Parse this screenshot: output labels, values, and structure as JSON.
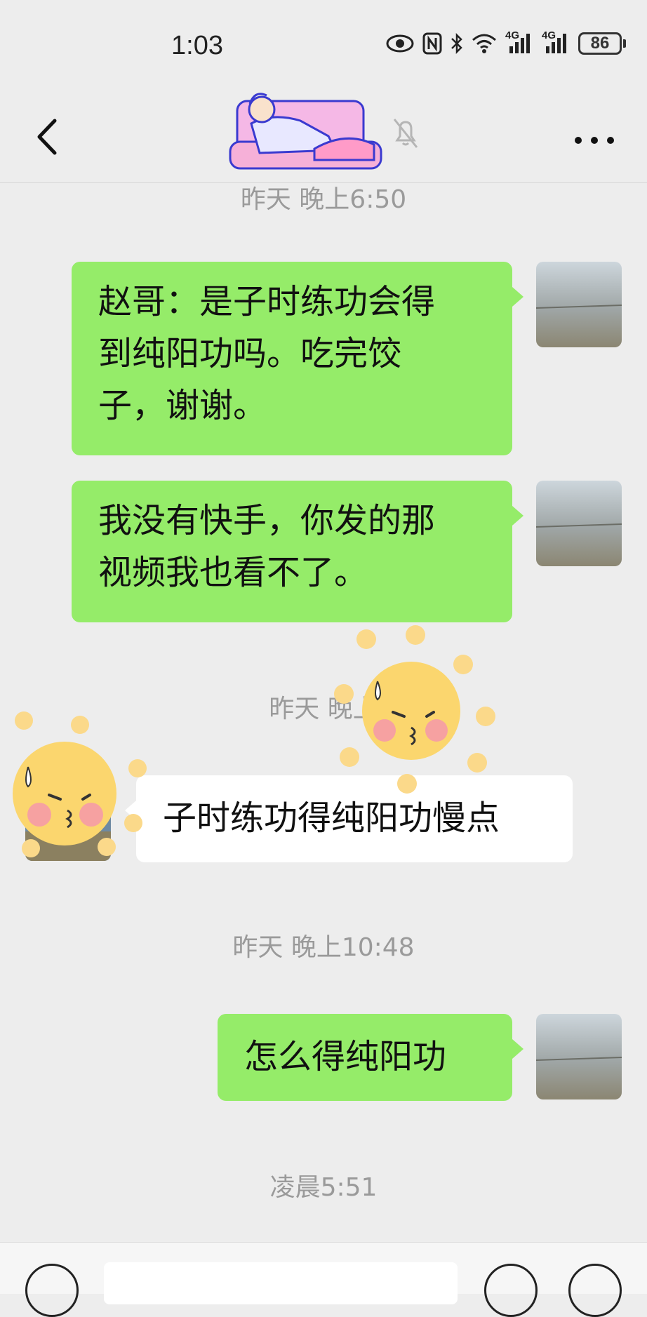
{
  "status_bar": {
    "time": "1:03",
    "network_1": "4G",
    "network_2": "4G",
    "battery": "86"
  },
  "nav": {
    "back_icon": "chevron-left-icon",
    "more_icon": "more-dots-icon",
    "mute_icon": "bell-off-icon"
  },
  "messages": [
    {
      "type": "timestamp",
      "text": "昨天 晚上6:50"
    },
    {
      "type": "sent",
      "lines": [
        "赵哥：是子时练功会得",
        "到纯阳功吗。吃完饺",
        "子，谢谢。"
      ]
    },
    {
      "type": "sent",
      "lines": [
        "我没有快手，你发的那",
        "视频我也看不了。"
      ]
    },
    {
      "type": "timestamp",
      "text": "昨天 晚上"
    },
    {
      "type": "received",
      "lines": [
        "子时练功得纯阳功慢点"
      ]
    },
    {
      "type": "timestamp",
      "text": "昨天 晚上10:48"
    },
    {
      "type": "sent",
      "lines": [
        "怎么得纯阳功"
      ]
    },
    {
      "type": "timestamp",
      "text": "凌晨5:51"
    }
  ],
  "colors": {
    "background": "#ededed",
    "sent_bubble": "#95ec69",
    "received_bubble": "#ffffff",
    "timestamp_text": "#9a9a9a"
  }
}
